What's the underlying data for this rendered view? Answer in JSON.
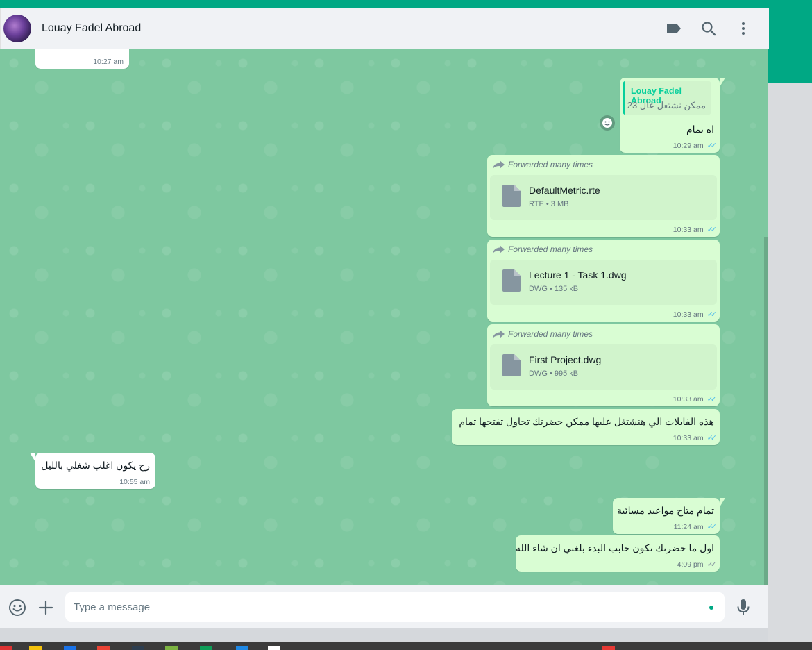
{
  "header": {
    "contact_name": "Louay Fadel Abroad"
  },
  "icons": {
    "label": "label-icon",
    "search": "search-icon",
    "menu": "kebab-menu-icon",
    "emoji": "emoji-icon",
    "attach": "plus-icon",
    "mic": "microphone-icon",
    "forward": "forward-arrow-icon",
    "document": "document-icon"
  },
  "colors": {
    "accent": "#00a884",
    "outgoing_bubble": "#d9fdd3",
    "incoming_bubble": "#ffffff",
    "read_ticks": "#53bdeb",
    "quote_author": "#06cf9c"
  },
  "messages": [
    {
      "dir": "in",
      "time": "10:27 am"
    },
    {
      "dir": "out",
      "quote_author": "Louay Fadel Abroad",
      "quote_text": "ممكن نشتغل عال 23",
      "text": "اه تمام",
      "time": "10:29 am",
      "status": "read"
    },
    {
      "dir": "out",
      "forwarded": "Forwarded many times",
      "file_name": "DefaultMetric.rte",
      "file_meta": "RTE • 3 MB",
      "time": "10:33 am",
      "status": "read"
    },
    {
      "dir": "out",
      "forwarded": "Forwarded many times",
      "file_name": "Lecture 1 - Task 1.dwg",
      "file_meta": "DWG • 135 kB",
      "time": "10:33 am",
      "status": "read"
    },
    {
      "dir": "out",
      "forwarded": "Forwarded many times",
      "file_name": "First Project.dwg",
      "file_meta": "DWG • 995 kB",
      "time": "10:33 am",
      "status": "read"
    },
    {
      "dir": "out",
      "text": "هذه الفايلات الي هنشتغل عليها ممكن حضرتك تحاول تفتحها تمام",
      "time": "10:33 am",
      "status": "read"
    },
    {
      "dir": "in",
      "text": "رح يكون اغلب شغلي بالليل",
      "time": "10:55 am"
    },
    {
      "dir": "out",
      "text": "تمام متاح مواعيد مسائية",
      "time": "11:24 am",
      "status": "read"
    },
    {
      "dir": "out",
      "text": "اول ما حضرتك تكون حابب البدء بلغني ان شاء الله",
      "time": "4:09 pm",
      "status": "delivered"
    }
  ],
  "composer": {
    "placeholder": "Type a message"
  }
}
